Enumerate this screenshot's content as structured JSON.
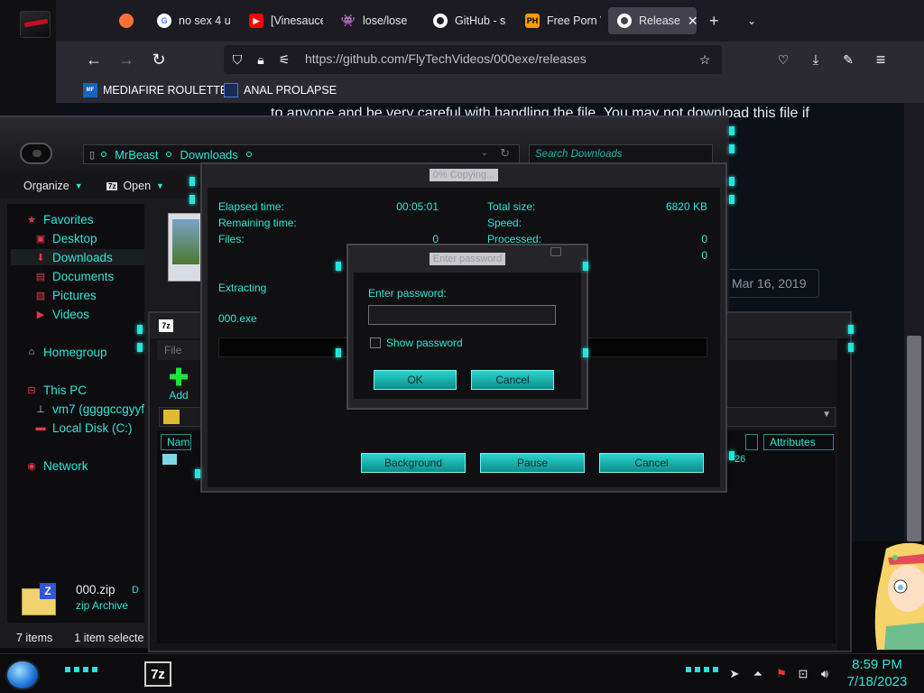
{
  "colors": {
    "accent": "#2ee6d6",
    "button": "#1bb8b3",
    "firefox_bg": "#1c1b22"
  },
  "firefox": {
    "tabs": [
      {
        "label": "no sex 4 u",
        "icon": "google-icon",
        "color": "#4285f4"
      },
      {
        "label": "[Vinesauce",
        "icon": "youtube-icon",
        "color": "#ff0000"
      },
      {
        "label": "lose/lose",
        "icon": "invader-icon",
        "color": "#ffffff"
      },
      {
        "label": "GitHub - s",
        "icon": "github-icon",
        "color": "#ffffff"
      },
      {
        "label": "Free Porn V",
        "icon": "ph-icon",
        "color": "#ff9900"
      },
      {
        "label": "Release",
        "icon": "github-icon",
        "color": "#ffffff",
        "active": true
      }
    ],
    "url": "https://github.com/FlyTechVideos/000exe/releases",
    "bookmarks": [
      {
        "label": "MEDIAFIRE ROULETTER"
      },
      {
        "label": "ANAL PROLAPSE"
      }
    ],
    "page": {
      "text": "to anyone and be very careful with handling the file. You may not download this file if",
      "date": "Mar 16, 2019"
    }
  },
  "explorer": {
    "breadcrumb": [
      "MrBeast",
      "Downloads"
    ],
    "search_placeholder": "Search Downloads",
    "toolbar": {
      "organize": "Organize",
      "open": "Open"
    },
    "nav": [
      {
        "label": "Favorites"
      },
      {
        "label": "Desktop"
      },
      {
        "label": "Downloads",
        "selected": true
      },
      {
        "label": "Documents"
      },
      {
        "label": "Pictures"
      },
      {
        "label": "Videos"
      },
      {
        "label": "Homegroup"
      },
      {
        "label": "This PC"
      },
      {
        "label": "vm7 (ggggccgyyf"
      },
      {
        "label": "Local Disk (C:)"
      },
      {
        "label": "Network"
      }
    ],
    "details": {
      "name": "000.zip",
      "type": "zip Archive",
      "extra": "D"
    },
    "status": {
      "items": "7 items",
      "selected": "1 item selecte"
    }
  },
  "filemanager": {
    "menu_file": "File",
    "add_label": "Add",
    "col_name": "Nam",
    "col_attributes": "Attributes",
    "cell_fragment": "26"
  },
  "progress_dialog": {
    "title": "0% Copying...",
    "elapsed_label": "Elapsed time:",
    "elapsed_value": "00:05:01",
    "remaining_label": "Remaining time:",
    "files_label": "Files:",
    "files_value": "0",
    "total_size_label": "Total size:",
    "total_size_value": "6820 KB",
    "speed_label": "Speed:",
    "processed_label": "Processed:",
    "processed_value": "0",
    "extra_value": "0",
    "status": "Extracting",
    "filename": "000.exe",
    "progress": 0,
    "buttons": {
      "background": "Background",
      "pause": "Pause",
      "cancel": "Cancel"
    }
  },
  "password_dialog": {
    "title": "Enter password",
    "label": "Enter password:",
    "value": "",
    "show_password": "Show password",
    "ok": "OK",
    "cancel": "Cancel"
  },
  "taskbar": {
    "app": "7z",
    "time": "8:59 PM",
    "date": "7/18/2023"
  }
}
